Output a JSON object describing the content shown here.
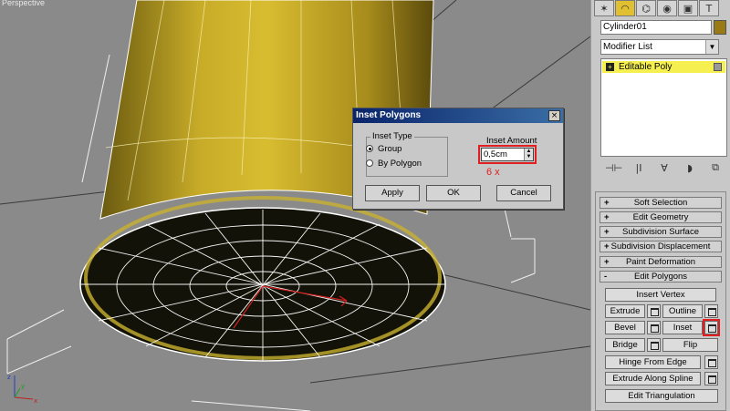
{
  "viewport": {
    "label": "Perspective"
  },
  "axes": {
    "x": "x",
    "y": "y",
    "z": "z"
  },
  "command_panel": {
    "tabs": [
      {
        "name": "create",
        "glyph": "✶"
      },
      {
        "name": "modify",
        "glyph": "◠"
      },
      {
        "name": "hierarchy",
        "glyph": "⌬"
      },
      {
        "name": "motion",
        "glyph": "◉"
      },
      {
        "name": "display",
        "glyph": "▣"
      },
      {
        "name": "utilities",
        "glyph": "T"
      }
    ],
    "object_name": "Cylinder01",
    "object_color": "#9a7a14",
    "modifier_list": "Modifier List",
    "stack_item": "Editable Poly",
    "stack_tools": [
      "⊣⊢",
      "|I",
      "∀",
      "◗",
      "⧉"
    ]
  },
  "rollouts": {
    "bars": [
      {
        "sign": "+",
        "label": "Soft Selection"
      },
      {
        "sign": "+",
        "label": "Edit Geometry"
      },
      {
        "sign": "+",
        "label": "Subdivision Surface"
      },
      {
        "sign": "+",
        "label": "Subdivision Displacement"
      },
      {
        "sign": "+",
        "label": "Paint Deformation"
      },
      {
        "sign": "-",
        "label": "Edit Polygons"
      }
    ],
    "buttons": {
      "insert_vertex": "Insert Vertex",
      "extrude": "Extrude",
      "outline": "Outline",
      "bevel": "Bevel",
      "inset": "Inset",
      "bridge": "Bridge",
      "flip": "Flip",
      "hinge": "Hinge From Edge",
      "extrude_spline": "Extrude Along Spline",
      "edit_tri": "Edit Triangulation"
    }
  },
  "dialog": {
    "title": "Inset Polygons",
    "close": "×",
    "group_label": "Inset Type",
    "option_group": "Group",
    "option_polygon": "By Polygon",
    "selected": "group",
    "amount_label": "Inset Amount",
    "amount_value": "0,5cm",
    "annotation": "6 x",
    "apply": "Apply",
    "ok": "OK",
    "cancel": "Cancel"
  }
}
